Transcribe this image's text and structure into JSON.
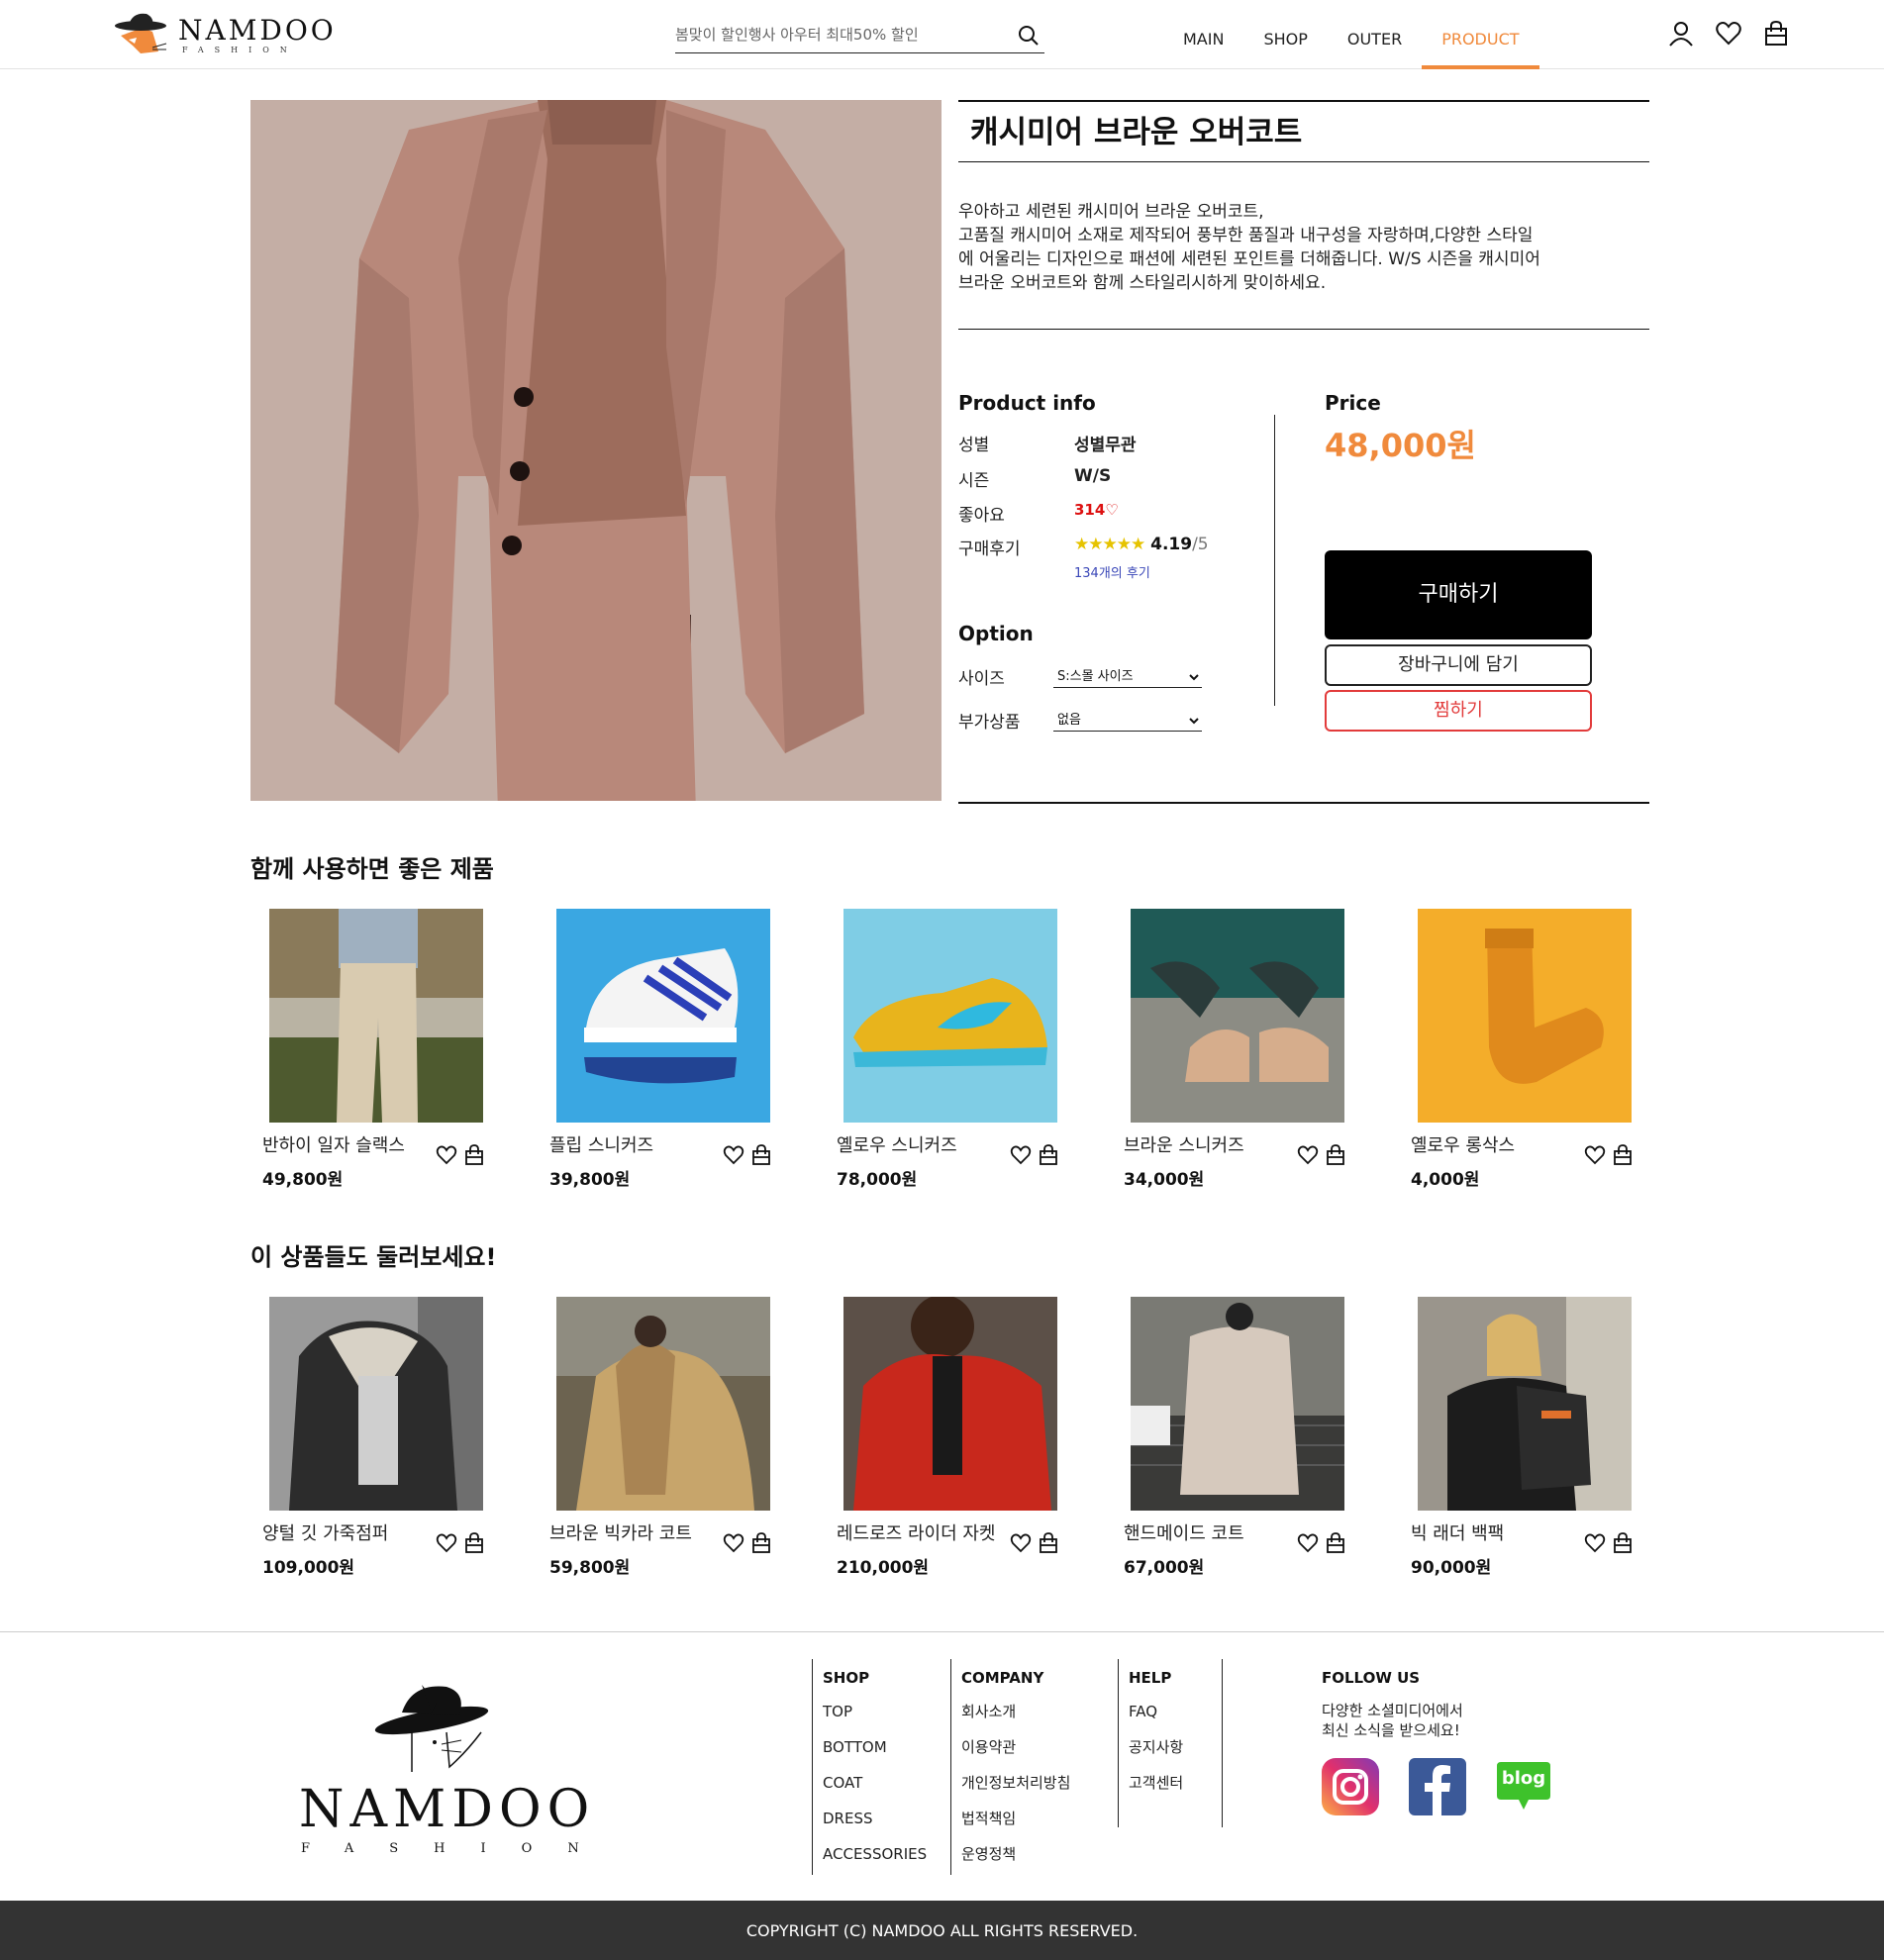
{
  "brand": {
    "name": "NAMDOO",
    "sub": "FASHION"
  },
  "search": {
    "placeholder": "봄맞이 할인행사 아우터 최대50% 할인"
  },
  "nav": [
    {
      "label": "MAIN",
      "active": false
    },
    {
      "label": "SHOP",
      "active": false
    },
    {
      "label": "OUTER",
      "active": false
    },
    {
      "label": "PRODUCT",
      "active": true
    }
  ],
  "product": {
    "title": "캐시미어 브라운 오버코트",
    "description": [
      "우아하고 세련된 캐시미어 브라운 오버코트,",
      "고품질 캐시미어 소재로 제작되어 풍부한 품질과 내구성을 자랑하며,다양한 스타일",
      "에 어울리는 디자인으로 패션에 세련된 포인트를 더해줍니다. W/S 시즌을 캐시미어",
      "브라운 오버코트와 함께 스타일리시하게 맞이하세요."
    ],
    "info_title": "Product info",
    "gender_label": "성별",
    "gender_value": "성별무관",
    "season_label": "시즌",
    "season_value": "W/S",
    "likes_label": "좋아요",
    "likes_value": "314♡",
    "review_label": "구매후기",
    "rating_stars": "★★★★★",
    "rating": "4.19",
    "rating_max": "/5",
    "review_count": "134개의 후기",
    "option_title": "Option",
    "size_label": "사이즈",
    "size_value": "S:스몰 사이즈",
    "addon_label": "부가상품",
    "addon_value": "없음",
    "price_title": "Price",
    "price": "48,000원",
    "buy_label": "구매하기",
    "cart_label": "장바구니에 담기",
    "wish_label": "찜하기"
  },
  "recommended": {
    "title": "함께 사용하면 좋은 제품",
    "items": [
      {
        "name": "반하이 일자 슬랙스",
        "price": "49,800원"
      },
      {
        "name": "플립 스니커즈",
        "price": "39,800원"
      },
      {
        "name": "옐로우 스니커즈",
        "price": "78,000원"
      },
      {
        "name": "브라운 스니커즈",
        "price": "34,000원"
      },
      {
        "name": "옐로우 롱삭스",
        "price": "4,000원"
      }
    ]
  },
  "browse": {
    "title": "이 상품들도 둘러보세요!",
    "items": [
      {
        "name": "양털 깃 가죽점퍼",
        "price": "109,000원"
      },
      {
        "name": "브라운 빅카라 코트",
        "price": "59,800원"
      },
      {
        "name": "레드로즈 라이더 자켓",
        "price": "210,000원"
      },
      {
        "name": "핸드메이드 코트",
        "price": "67,000원"
      },
      {
        "name": "빅 래더 백팩",
        "price": "90,000원"
      }
    ]
  },
  "footer": {
    "shop": {
      "title": "SHOP",
      "links": [
        "TOP",
        "BOTTOM",
        "COAT",
        "DRESS",
        "ACCESSORIES"
      ]
    },
    "company": {
      "title": "COMPANY",
      "links": [
        "회사소개",
        "이용약관",
        "개인정보처리방침",
        "법적책임",
        "운영정책"
      ]
    },
    "help": {
      "title": "HELP",
      "links": [
        "FAQ",
        "공지사항",
        "고객센터"
      ]
    },
    "follow": {
      "title": "FOLLOW US",
      "text_line1": "다양한 소셜미디어에서",
      "text_line2": "최신 소식을 받으세요!",
      "blog_label": "blog"
    },
    "copyright": "COPYRIGHT (C) NAMDOO ALL RIGHTS RESERVED."
  },
  "colors": {
    "accent": "#f08a3c",
    "wish": "#e23b3b",
    "likes": "#dd1111",
    "review_link": "#3b48b8",
    "footer_bar": "#333333"
  }
}
